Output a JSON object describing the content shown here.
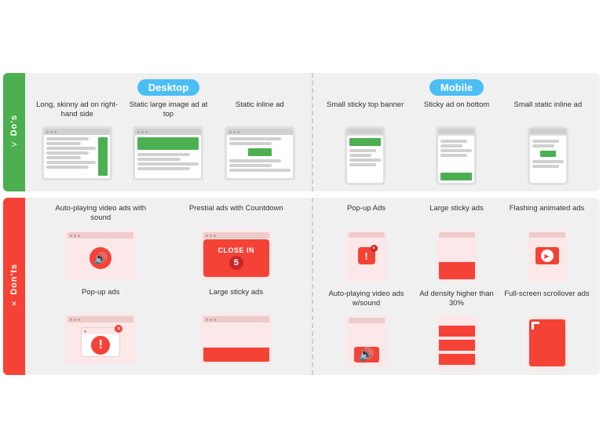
{
  "dos": {
    "label": "Do's",
    "icon": ">",
    "desktop": {
      "label": "Desktop",
      "ads": [
        {
          "id": "long-skinny",
          "text": "Long, skinny ad on right-hand side"
        },
        {
          "id": "static-large",
          "text": "Static large image ad at top"
        },
        {
          "id": "static-inline",
          "text": "Static inline ad"
        }
      ]
    },
    "mobile": {
      "label": "Mobile",
      "ads": [
        {
          "id": "small-sticky-top",
          "text": "Small sticky top banner"
        },
        {
          "id": "sticky-bottom",
          "text": "Sticky ad on bottom"
        },
        {
          "id": "small-static-inline",
          "text": "Small static inline ad"
        }
      ]
    }
  },
  "donts": {
    "label": "Don'ts",
    "icon": "×",
    "desktop": {
      "ads_row1": [
        {
          "id": "autoplaying-video",
          "text": "Auto-playing video ads with sound"
        },
        {
          "id": "prestial-countdown",
          "text": "Prestial ads with Countdown"
        }
      ],
      "ads_row2": [
        {
          "id": "popup-ads-desktop",
          "text": "Pop-up ads"
        },
        {
          "id": "large-sticky-desktop",
          "text": "Large sticky ads"
        }
      ]
    },
    "mobile": {
      "ads_row1": [
        {
          "id": "popup-ads-mobile",
          "text": "Pop-up Ads"
        },
        {
          "id": "large-sticky-mobile",
          "text": "Large sticky ads"
        },
        {
          "id": "flashing-animated",
          "text": "Flashing animated ads"
        }
      ],
      "ads_row2": [
        {
          "id": "autoplaying-video-mobile",
          "text": "Auto-playing video ads w/sound"
        },
        {
          "id": "ad-density",
          "text": "Ad density higher than 30%"
        },
        {
          "id": "fullscreen-scrollover",
          "text": "Full-screen scrollover ads"
        }
      ]
    },
    "close_in": "CLOSE IN",
    "close_in_num": "5"
  }
}
